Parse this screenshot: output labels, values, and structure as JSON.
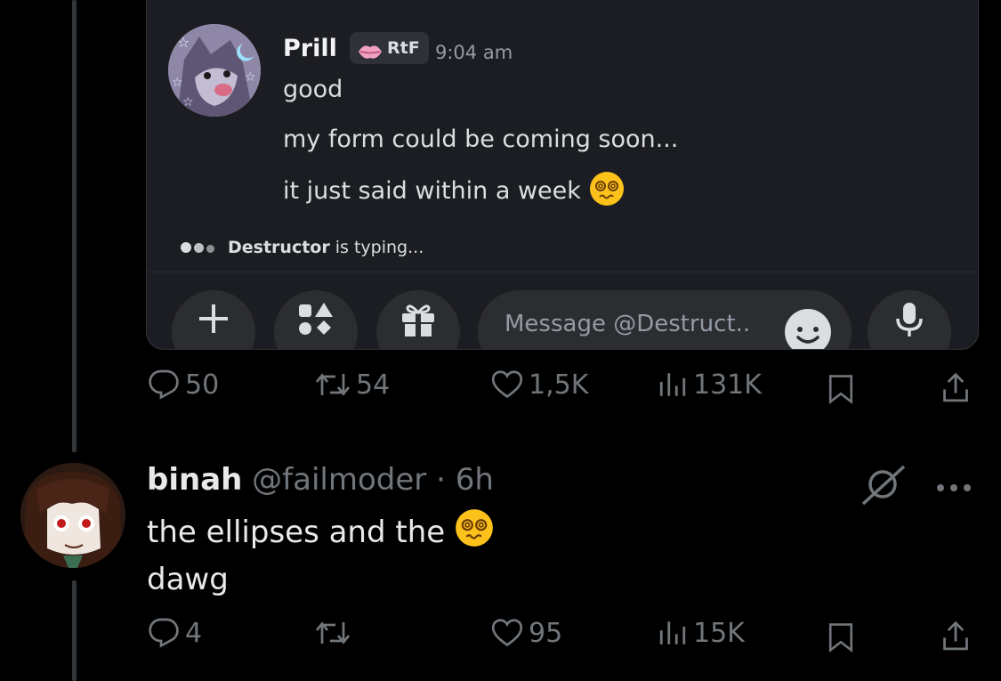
{
  "quoted_chat": {
    "message": {
      "author": "Prill",
      "tag": "RtF",
      "time": "9:04 am",
      "lines": [
        "good",
        "my form could be coming soon...",
        "it just said within a week"
      ]
    },
    "typing": {
      "user": "Destructor",
      "suffix": "is typing..."
    },
    "composer": {
      "placeholder": "Message @Destruct.."
    }
  },
  "post_actions": {
    "replies": "50",
    "reposts": "54",
    "likes": "1,5K",
    "views": "131K"
  },
  "reply": {
    "display_name": "binah",
    "handle": "@failmoder",
    "separator": "·",
    "age": "6h",
    "text_line1": "the ellipses and the",
    "text_line2": "dawg",
    "actions": {
      "replies": "4",
      "reposts": "",
      "likes": "95",
      "views": "15K"
    }
  },
  "icons": {
    "reply": "reply-bubble-icon",
    "repost": "repost-icon",
    "like": "heart-icon",
    "views": "views-bars-icon",
    "bookmark": "bookmark-icon",
    "share": "share-icon",
    "emoji": "dizzy-face-emoji",
    "grok": "grok-icon",
    "more": "more-icon"
  },
  "colors": {
    "background": "#000000",
    "muted": "#71767b",
    "text": "#e7e9ea",
    "discord_bg": "#1c1d22"
  }
}
